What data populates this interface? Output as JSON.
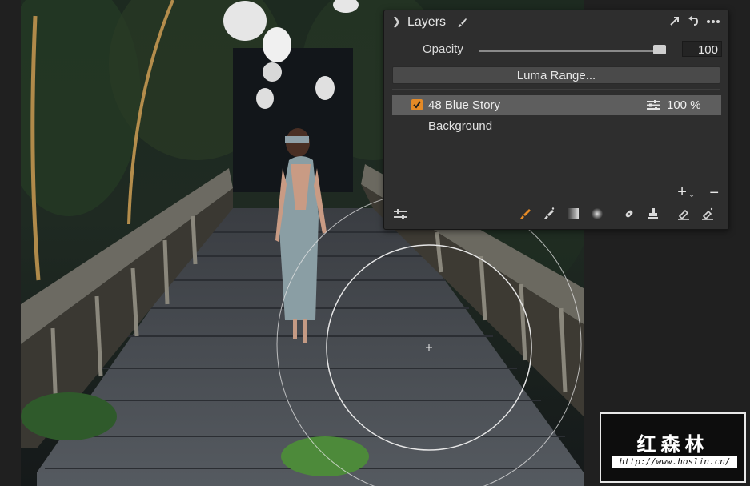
{
  "layers_panel": {
    "title": "Layers",
    "opacity_label": "Opacity",
    "opacity_value": "100",
    "opacity_level": 1.0,
    "luma_button": "Luma Range...",
    "layers": [
      {
        "name": "48 Blue Story",
        "opacity": "100 %",
        "checked": true,
        "selected": true
      },
      {
        "name": "Background",
        "selected": false
      }
    ],
    "icons": {
      "collapse": "chevron-down-icon",
      "edit": "brush-icon",
      "detach": "detach-arrow-icon",
      "reset": "undo-arrow-icon",
      "more": "more-dots-icon",
      "add": "plus-icon",
      "remove": "minus-icon",
      "adjustments": "sliders-icon"
    },
    "accent_color": "#e58a26"
  },
  "watermark": {
    "title": "红森林",
    "url": "http://www.hoslin.cn/"
  }
}
